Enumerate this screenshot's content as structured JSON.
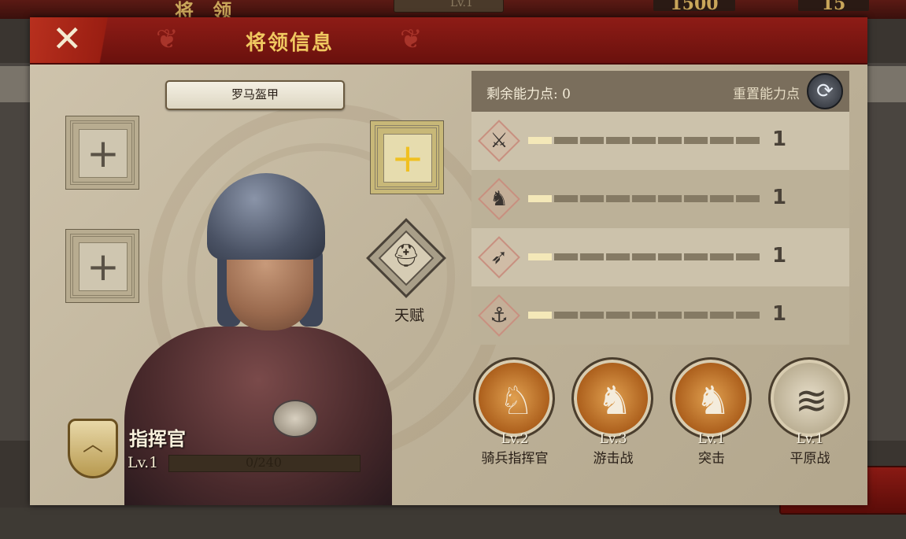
{
  "background": {
    "top_title": "将 领",
    "top_level": "Lv.1",
    "resource_coins": "1500",
    "resource_other": "15"
  },
  "header": {
    "title": "将领信息",
    "close_icon": "close-x-icon"
  },
  "equipment": {
    "armor_label": "罗马盔甲",
    "slots": [
      "empty-slot",
      "empty-slot",
      "gold-slot"
    ]
  },
  "talent": {
    "label": "天赋",
    "icon": "helmet-icon"
  },
  "commander": {
    "title": "指挥官",
    "level": "Lv.1",
    "xp_text": "0/240",
    "xp_progress": 0
  },
  "stats": {
    "remaining_label": "剩余能力点: 0",
    "reset_label": "重置能力点",
    "reset_icon": "refresh-icon",
    "rows": [
      {
        "icon": "sword-icon",
        "value": "1",
        "filled": 1,
        "total": 9
      },
      {
        "icon": "horse-icon",
        "value": "1",
        "filled": 1,
        "total": 9
      },
      {
        "icon": "bow-icon",
        "value": "1",
        "filled": 1,
        "total": 9
      },
      {
        "icon": "anchor-icon",
        "value": "1",
        "filled": 1,
        "total": 9
      }
    ]
  },
  "skills": [
    {
      "level": "Lv.2",
      "name": "骑兵指挥官",
      "icon": "horse-head-icon"
    },
    {
      "level": "Lv.3",
      "name": "游击战",
      "icon": "horsemen-icon"
    },
    {
      "level": "Lv.1",
      "name": "突击",
      "icon": "charging-rider-icon"
    },
    {
      "level": "Lv.1",
      "name": "平原战",
      "icon": "plains-icon"
    }
  ]
}
